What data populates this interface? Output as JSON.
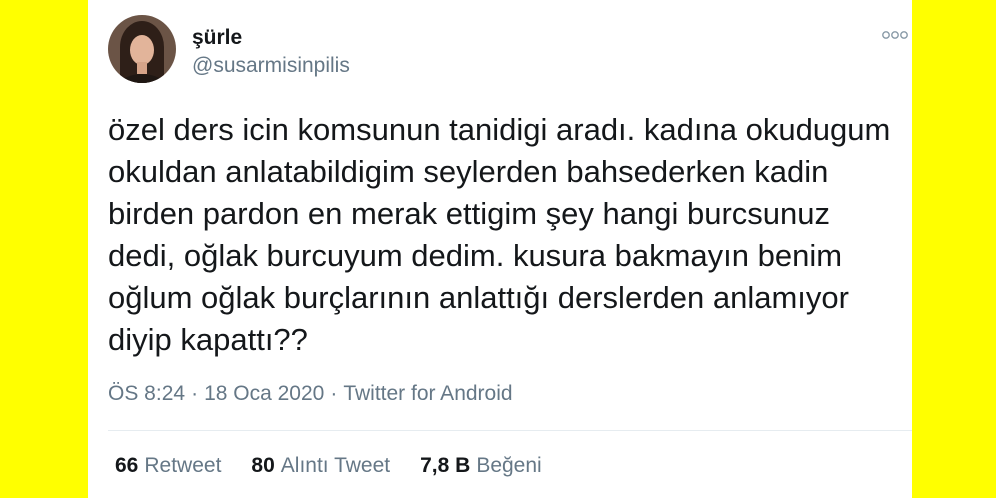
{
  "colors": {
    "background": "#ffff00",
    "card": "#ffffff",
    "text": "#14171a",
    "secondary": "#657786",
    "divider": "#e6ecf0",
    "icon": "#8899a6"
  },
  "tweet": {
    "author": {
      "name": "şürle",
      "handle": "@susarmisinpilis",
      "avatar_icon": "avatar-photo"
    },
    "more_icon": "more-icon",
    "text_lines": [
      "özel ders icin komsunun tanidigi aradı. kadına okudugum",
      "okuldan anlatabildigim seylerden bahsederken kadin",
      "birden pardon en merak ettigim şey hangi burcsunuz",
      "dedi, oğlak burcuyum dedim. kusura bakmayın benim",
      "oğlum oğlak burçlarının anlattığı derslerden anlamıyor",
      "diyip kapattı??"
    ],
    "meta": {
      "time": "ÖS 8:24",
      "separator": "·",
      "date": "18 Oca 2020",
      "source": "Twitter for Android"
    },
    "stats": [
      {
        "value": "66",
        "label": "Retweet"
      },
      {
        "value": "80",
        "label": "Alıntı Tweet"
      },
      {
        "value": "7,8 B",
        "label": "Beğeni"
      }
    ]
  }
}
